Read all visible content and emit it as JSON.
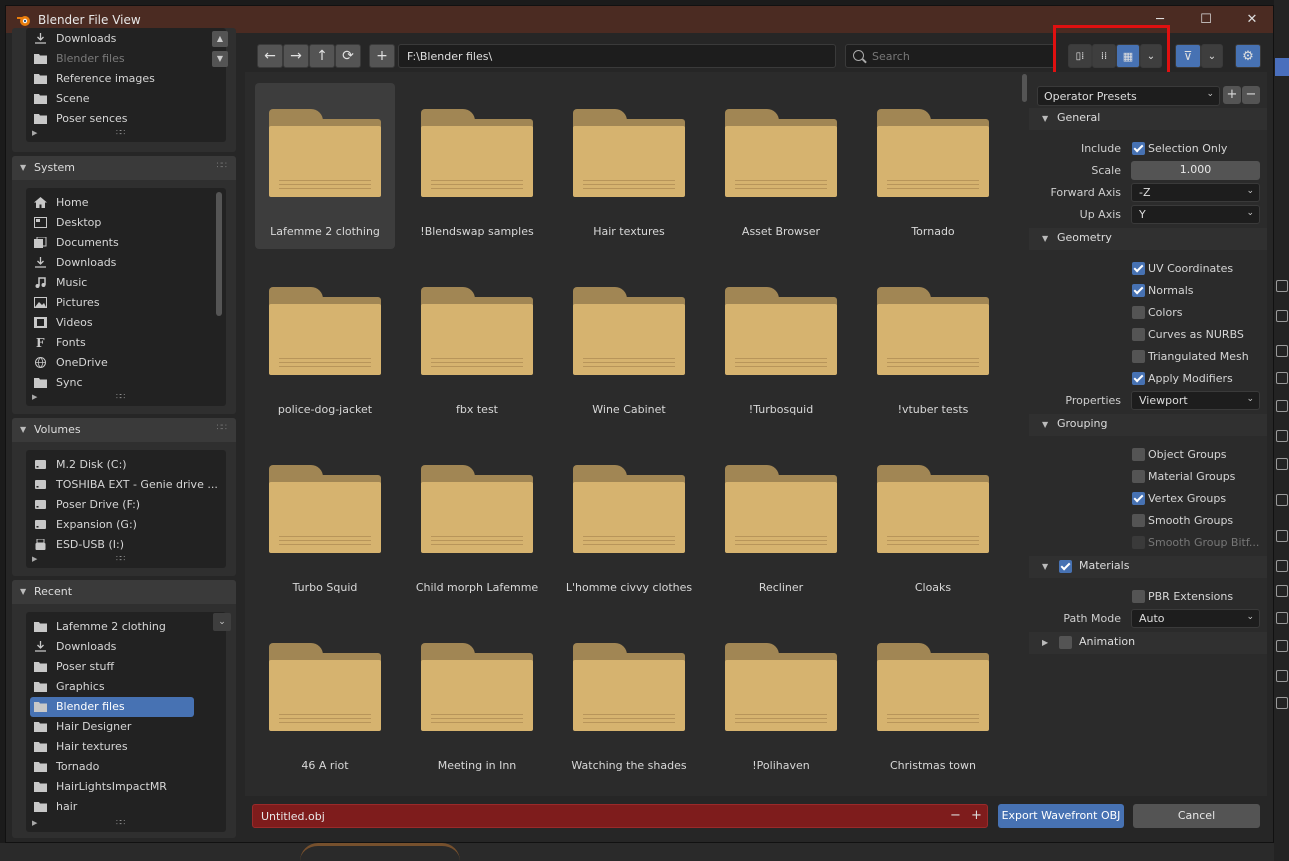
{
  "window": {
    "title": "Blender File View",
    "minimize": "─",
    "maximize": "☐",
    "close": "✕"
  },
  "bookmarks_top": [
    {
      "label": "Downloads",
      "icon": "download-icon",
      "dim": false
    },
    {
      "label": "Blender files",
      "icon": "folder-icon",
      "dim": true
    },
    {
      "label": "Reference images",
      "icon": "folder-icon",
      "dim": false
    },
    {
      "label": "Scene",
      "icon": "folder-icon",
      "dim": false
    },
    {
      "label": "Poser sences",
      "icon": "folder-icon",
      "dim": false
    }
  ],
  "system": {
    "title": "System",
    "items": [
      {
        "label": "Home",
        "icon": "home-icon"
      },
      {
        "label": "Desktop",
        "icon": "desktop-icon"
      },
      {
        "label": "Documents",
        "icon": "documents-icon"
      },
      {
        "label": "Downloads",
        "icon": "download-icon"
      },
      {
        "label": "Music",
        "icon": "music-icon"
      },
      {
        "label": "Pictures",
        "icon": "pictures-icon"
      },
      {
        "label": "Videos",
        "icon": "videos-icon"
      },
      {
        "label": "Fonts",
        "icon": "fonts-icon"
      },
      {
        "label": "OneDrive",
        "icon": "globe-icon"
      },
      {
        "label": "Sync",
        "icon": "folder-icon"
      }
    ]
  },
  "volumes": {
    "title": "Volumes",
    "items": [
      {
        "label": "M.2 Disk (C:)",
        "icon": "disk-icon"
      },
      {
        "label": "TOSHIBA EXT - Genie drive ...",
        "icon": "disk-icon"
      },
      {
        "label": "Poser Drive (F:)",
        "icon": "disk-icon"
      },
      {
        "label": "Expansion (G:)",
        "icon": "disk-icon"
      },
      {
        "label": "ESD-USB (I:)",
        "icon": "usb-icon"
      }
    ]
  },
  "recent": {
    "title": "Recent",
    "items": [
      {
        "label": "Lafemme 2 clothing",
        "icon": "folder-icon",
        "selected": false
      },
      {
        "label": "Downloads",
        "icon": "download-icon",
        "selected": false
      },
      {
        "label": "Poser stuff",
        "icon": "folder-icon",
        "selected": false
      },
      {
        "label": "Graphics",
        "icon": "folder-icon",
        "selected": false
      },
      {
        "label": "Blender files",
        "icon": "folder-icon",
        "selected": true
      },
      {
        "label": "Hair Designer",
        "icon": "folder-icon",
        "selected": false
      },
      {
        "label": "Hair textures",
        "icon": "folder-icon",
        "selected": false
      },
      {
        "label": "Tornado",
        "icon": "folder-icon",
        "selected": false
      },
      {
        "label": "HairLightsImpactMR",
        "icon": "folder-icon",
        "selected": false
      },
      {
        "label": "hair",
        "icon": "folder-icon",
        "selected": false
      }
    ]
  },
  "toolbar": {
    "back": "←",
    "forward": "→",
    "parent": "↑",
    "refresh": "⟳",
    "new_folder": "+",
    "path": "F:\\Blender files\\",
    "search_placeholder": "Search"
  },
  "folders": [
    {
      "name": "Lafemme 2 clothing",
      "selected": true
    },
    {
      "name": "!Blendswap samples",
      "selected": false
    },
    {
      "name": "Hair textures",
      "selected": false
    },
    {
      "name": "Asset Browser",
      "selected": false
    },
    {
      "name": "Tornado",
      "selected": false
    },
    {
      "name": "police-dog-jacket",
      "selected": false
    },
    {
      "name": "fbx test",
      "selected": false
    },
    {
      "name": "Wine Cabinet",
      "selected": false
    },
    {
      "name": "!Turbosquid",
      "selected": false
    },
    {
      "name": "!vtuber tests",
      "selected": false
    },
    {
      "name": "Turbo Squid",
      "selected": false
    },
    {
      "name": "Child morph Lafemme",
      "selected": false
    },
    {
      "name": "L'homme civvy clothes",
      "selected": false
    },
    {
      "name": "Recliner",
      "selected": false
    },
    {
      "name": "Cloaks",
      "selected": false
    },
    {
      "name": "46 A riot",
      "selected": false
    },
    {
      "name": "Meeting in Inn",
      "selected": false
    },
    {
      "name": "Watching the shades",
      "selected": false
    },
    {
      "name": "!Polihaven",
      "selected": false
    },
    {
      "name": "Christmas town",
      "selected": false
    }
  ],
  "bottom": {
    "filename": "Untitled.obj",
    "minus": "−",
    "plus": "+",
    "export_label": "Export Wavefront OBJ",
    "cancel_label": "Cancel"
  },
  "operator": {
    "presets_label": "Operator Presets",
    "general": {
      "title": "General",
      "include_label": "Include",
      "selection_only": {
        "label": "Selection Only",
        "checked": true
      },
      "scale_label": "Scale",
      "scale_value": "1.000",
      "forward_axis_label": "Forward Axis",
      "forward_axis_value": "-Z",
      "up_axis_label": "Up Axis",
      "up_axis_value": "Y"
    },
    "geometry": {
      "title": "Geometry",
      "checks": [
        {
          "label": "UV Coordinates",
          "checked": true
        },
        {
          "label": "Normals",
          "checked": true
        },
        {
          "label": "Colors",
          "checked": false
        },
        {
          "label": "Curves as NURBS",
          "checked": false
        },
        {
          "label": "Triangulated Mesh",
          "checked": false
        },
        {
          "label": "Apply Modifiers",
          "checked": true
        }
      ],
      "properties_label": "Properties",
      "properties_value": "Viewport"
    },
    "grouping": {
      "title": "Grouping",
      "checks": [
        {
          "label": "Object Groups",
          "checked": false
        },
        {
          "label": "Material Groups",
          "checked": false
        },
        {
          "label": "Vertex Groups",
          "checked": true
        },
        {
          "label": "Smooth Groups",
          "checked": false
        },
        {
          "label": "Smooth Group Bitf...",
          "checked": false,
          "disabled": true
        }
      ]
    },
    "materials": {
      "title": "Materials",
      "enabled": true,
      "pbr": {
        "label": "PBR Extensions",
        "checked": false
      },
      "path_mode_label": "Path Mode",
      "path_mode_value": "Auto"
    },
    "animation": {
      "title": "Animation",
      "enabled": false
    }
  },
  "colors": {
    "accent": "#4772b3",
    "titlebar": "#4b2b22",
    "folder": "#d6b36f",
    "filename_error": "#7e1c1c",
    "highlight": "#e01010"
  }
}
